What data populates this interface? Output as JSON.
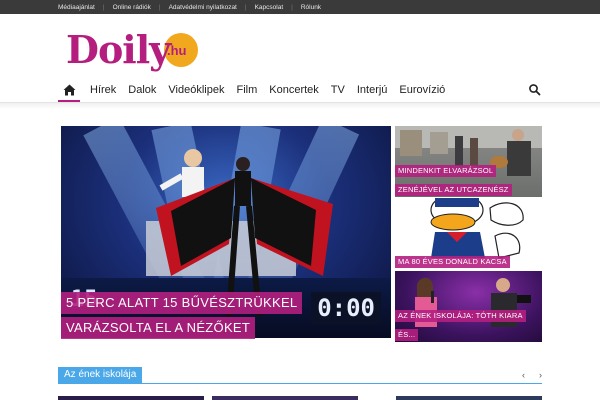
{
  "topbar": {
    "links": [
      "Médiaajánlat",
      "Online rádiók",
      "Adatvédelmi nyilatkozat",
      "Kapcsolat",
      "Rólunk"
    ]
  },
  "logo": {
    "word": "Doily",
    "tld": ".hu"
  },
  "nav": {
    "items": [
      "Hírek",
      "Dalok",
      "Videóklipek",
      "Film",
      "Koncertek",
      "TV",
      "Interjú",
      "Eurovízió"
    ],
    "icons": {
      "home": "home-icon",
      "search": "search-icon"
    },
    "active": "home"
  },
  "featured": {
    "main": {
      "caption_line1": "5 PERC ALATT 15 BŰVÉSZTRÜKKEL",
      "caption_line2": "VARÁZSOLTA EL A NÉZŐKET",
      "scoreboard_left": "15",
      "scoreboard_right": "0:00"
    },
    "side": [
      {
        "caption_line1": "MINDENKIT ELVARÁZSOL",
        "caption_line2": "ZENÉJÉVEL AZ UTCAZENÉSZ"
      },
      {
        "caption_line1": "MA 80 ÉVES DONALD KACSA"
      },
      {
        "caption_line1": "AZ ÉNEK ISKOLÁJA: TÓTH KIARA",
        "caption_line2": "ÉS..."
      }
    ]
  },
  "section": {
    "title": "Az ének iskolája",
    "prev": "‹",
    "next": "›"
  },
  "colors": {
    "brand": "#b41f7f",
    "logo_circle": "#f2a81e",
    "section_accent": "#4aa7e8",
    "topbar": "#3a3a3a"
  }
}
